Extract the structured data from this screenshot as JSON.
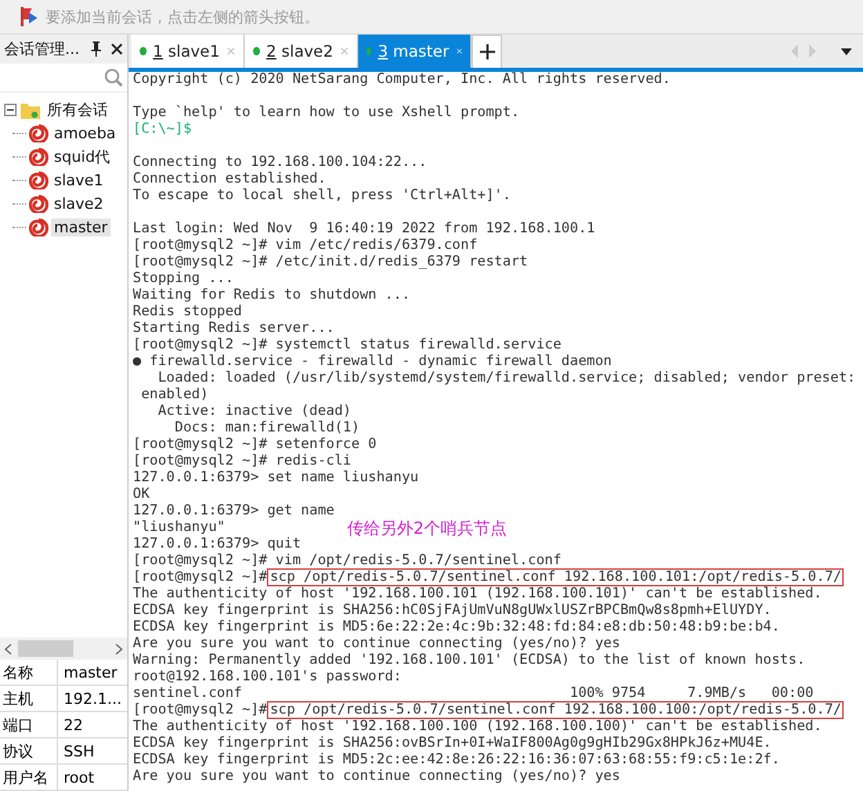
{
  "hint_bar": {
    "text": "要添加当前会话，点击左侧的箭头按钮。"
  },
  "session_panel": {
    "title": "会话管理...",
    "tree": [
      {
        "label": "所有会话",
        "expanded": true,
        "children": [
          {
            "label": "amoeba",
            "selected": false
          },
          {
            "label": "squid代",
            "selected": false
          },
          {
            "label": "slave1",
            "selected": false
          },
          {
            "label": "slave2",
            "selected": false
          },
          {
            "label": "master",
            "selected": true
          }
        ]
      }
    ],
    "properties": [
      {
        "name": "名称",
        "value": "master"
      },
      {
        "name": "主机",
        "value": "192.1..."
      },
      {
        "name": "端口",
        "value": "22"
      },
      {
        "name": "协议",
        "value": "SSH"
      },
      {
        "name": "用户名",
        "value": "root"
      }
    ]
  },
  "tabs": [
    {
      "number": "1",
      "label": "slave1",
      "selected": false
    },
    {
      "number": "2",
      "label": "slave2",
      "selected": false
    },
    {
      "number": "3",
      "label": "master",
      "selected": true
    }
  ],
  "terminal": {
    "lines": [
      {
        "kind": "text",
        "text": "Copyright (c) 2020 NetSarang Computer, Inc. All rights reserved."
      },
      {
        "kind": "blank"
      },
      {
        "kind": "text",
        "text": "Type `help' to learn how to use Xshell prompt."
      },
      {
        "kind": "local",
        "text": "[C:\\~]$"
      },
      {
        "kind": "blank"
      },
      {
        "kind": "text",
        "text": "Connecting to 192.168.100.104:22..."
      },
      {
        "kind": "text",
        "text": "Connection established."
      },
      {
        "kind": "text",
        "text": "To escape to local shell, press 'Ctrl+Alt+]'."
      },
      {
        "kind": "blank"
      },
      {
        "kind": "text",
        "text": "Last login: Wed Nov  9 16:40:19 2022 from 192.168.100.1"
      },
      {
        "kind": "text",
        "text": "[root@mysql2 ~]# vim /etc/redis/6379.conf"
      },
      {
        "kind": "text",
        "text": "[root@mysql2 ~]# /etc/init.d/redis_6379 restart"
      },
      {
        "kind": "text",
        "text": "Stopping ..."
      },
      {
        "kind": "text",
        "text": "Waiting for Redis to shutdown ..."
      },
      {
        "kind": "text",
        "text": "Redis stopped"
      },
      {
        "kind": "text",
        "text": "Starting Redis server..."
      },
      {
        "kind": "text",
        "text": "[root@mysql2 ~]# systemctl status firewalld.service"
      },
      {
        "kind": "text",
        "text": "● firewalld.service - firewalld - dynamic firewall daemon"
      },
      {
        "kind": "text",
        "text": "   Loaded: loaded (/usr/lib/systemd/system/firewalld.service; disabled; vendor preset:"
      },
      {
        "kind": "text",
        "text": " enabled)"
      },
      {
        "kind": "text",
        "text": "   Active: inactive (dead)"
      },
      {
        "kind": "text",
        "text": "     Docs: man:firewalld(1)"
      },
      {
        "kind": "text",
        "text": "[root@mysql2 ~]# setenforce 0"
      },
      {
        "kind": "text",
        "text": "[root@mysql2 ~]# redis-cli"
      },
      {
        "kind": "text",
        "text": "127.0.0.1:6379> set name liushanyu"
      },
      {
        "kind": "text",
        "text": "OK"
      },
      {
        "kind": "text",
        "text": "127.0.0.1:6379> get name"
      },
      {
        "kind": "annotated",
        "text": "\"liushanyu\"",
        "note": "传给另外2个哨兵节点"
      },
      {
        "kind": "text",
        "text": "127.0.0.1:6379> quit"
      },
      {
        "kind": "text",
        "text": "[root@mysql2 ~]# vim /opt/redis-5.0.7/sentinel.conf"
      },
      {
        "kind": "boxed",
        "text": "[root@mysql2 ~]#",
        "command": "scp /opt/redis-5.0.7/sentinel.conf 192.168.100.101:/opt/redis-5.0.7/"
      },
      {
        "kind": "text",
        "text": "The authenticity of host '192.168.100.101 (192.168.100.101)' can't be established."
      },
      {
        "kind": "text",
        "text": "ECDSA key fingerprint is SHA256:hC0SjFAjUmVuN8gUWxlUSZrBPCBmQw8s8pmh+ElUYDY."
      },
      {
        "kind": "text",
        "text": "ECDSA key fingerprint is MD5:6e:22:2e:4c:9b:32:48:fd:84:e8:db:50:48:b9:be:b4."
      },
      {
        "kind": "text",
        "text": "Are you sure you want to continue connecting (yes/no)? yes"
      },
      {
        "kind": "text",
        "text": "Warning: Permanently added '192.168.100.101' (ECDSA) to the list of known hosts."
      },
      {
        "kind": "text",
        "text": "root@192.168.100.101's password:"
      },
      {
        "kind": "text",
        "text": "sentinel.conf                                       100% 9754     7.9MB/s   00:00"
      },
      {
        "kind": "boxed",
        "text": "[root@mysql2 ~]#",
        "command": "scp /opt/redis-5.0.7/sentinel.conf 192.168.100.100:/opt/redis-5.0.7/"
      },
      {
        "kind": "text",
        "text": "The authenticity of host '192.168.100.100 (192.168.100.100)' can't be established."
      },
      {
        "kind": "text",
        "text": "ECDSA key fingerprint is SHA256:ovBSrIn+0I+WaIF800Ag0g9gHIb29Gx8HPkJ6z+MU4E."
      },
      {
        "kind": "text",
        "text": "ECDSA key fingerprint is MD5:2c:ee:42:8e:26:22:16:36:07:63:68:55:f9:c5:1e:2f."
      },
      {
        "kind": "text",
        "text": "Are you sure you want to continue connecting (yes/no)? yes"
      }
    ]
  }
}
